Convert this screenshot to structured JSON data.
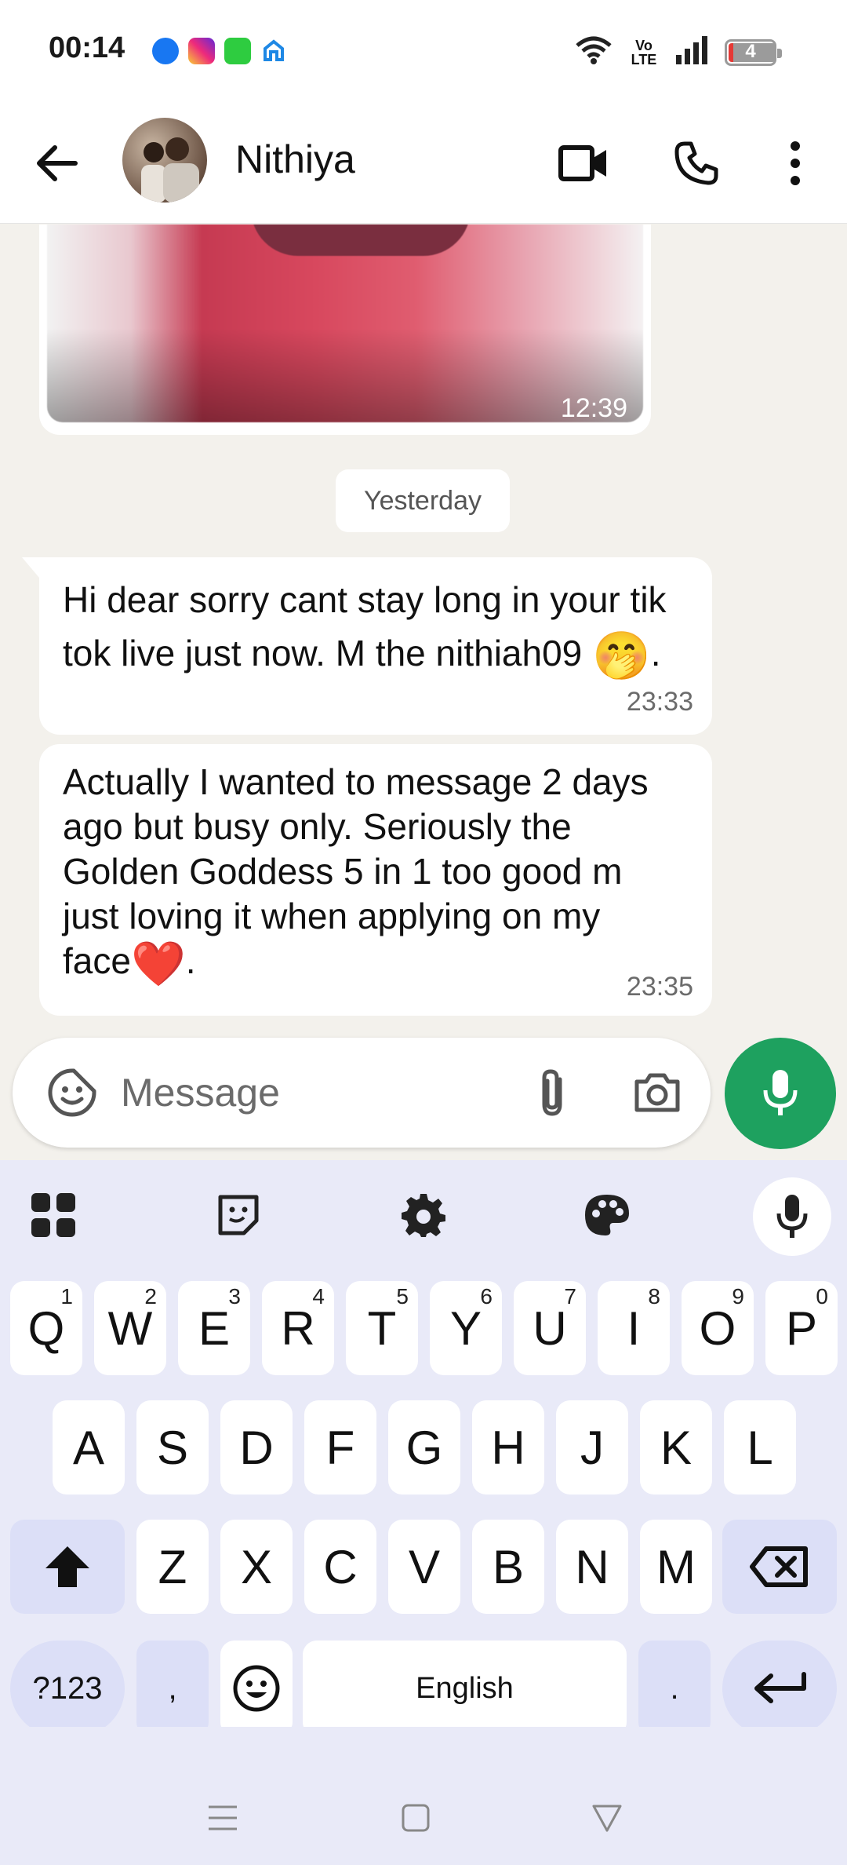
{
  "status_bar": {
    "time": "00:14",
    "notification_icons": [
      "messenger-icon",
      "instagram-icon",
      "app-icon",
      "home-app-icon"
    ],
    "network": "Vo LTE",
    "battery": "4"
  },
  "header": {
    "contact_name": "Nithiya",
    "back_icon": "arrow-left-icon",
    "video_icon": "video-call-icon",
    "call_icon": "phone-icon",
    "menu_icon": "more-vert-icon"
  },
  "messages": [
    {
      "type": "image",
      "time": "12:39"
    },
    {
      "type": "date",
      "label": "Yesterday"
    },
    {
      "type": "text",
      "text": "Hi dear sorry cant stay long in your tik tok live just now. M the nithiah09 🤭.",
      "time": "23:33"
    },
    {
      "type": "text",
      "text": "Actually I wanted to message 2 days ago but busy only. Seriously the Golden Goddess 5 in 1 too good m just loving it when applying on my face❤️.",
      "time": "23:35"
    }
  ],
  "msg1": {
    "line1": "Hi dear sorry cant stay long in your tik",
    "line2a": "tok live just now. M the nithiah09 ",
    "emoji": "🤭",
    "line2b": ".",
    "time": "23:33"
  },
  "msg2": {
    "line1": "Actually I wanted to message 2 days",
    "line2": "ago but busy only. Seriously the",
    "line3": "Golden Goddess 5 in 1 too good m",
    "line4": "just loving it when applying on my",
    "line5a": "face",
    "emoji": "❤️",
    "line5b": ".",
    "time": "23:35"
  },
  "composer": {
    "placeholder": "Message",
    "sticker_icon": "sticker-icon",
    "attach_icon": "paperclip-icon",
    "camera_icon": "camera-icon",
    "mic_icon": "mic-icon"
  },
  "keyboard": {
    "toolbar": [
      "apps-grid-icon",
      "sticker-icon",
      "gear-icon",
      "palette-icon",
      "mic-icon"
    ],
    "row1": [
      {
        "k": "Q",
        "h": "1"
      },
      {
        "k": "W",
        "h": "2"
      },
      {
        "k": "E",
        "h": "3"
      },
      {
        "k": "R",
        "h": "4"
      },
      {
        "k": "T",
        "h": "5"
      },
      {
        "k": "Y",
        "h": "6"
      },
      {
        "k": "U",
        "h": "7"
      },
      {
        "k": "I",
        "h": "8"
      },
      {
        "k": "O",
        "h": "9"
      },
      {
        "k": "P",
        "h": "0"
      }
    ],
    "row2": [
      "A",
      "S",
      "D",
      "F",
      "G",
      "H",
      "J",
      "K",
      "L"
    ],
    "row3": [
      "Z",
      "X",
      "C",
      "V",
      "B",
      "N",
      "M"
    ],
    "symbols_label": "?123",
    "comma": ",",
    "period": ".",
    "space_label": "English"
  },
  "colors": {
    "accent_green": "#1ea15f",
    "chat_background": "#f3f1ec",
    "keyboard_background": "#e9eaf8"
  }
}
